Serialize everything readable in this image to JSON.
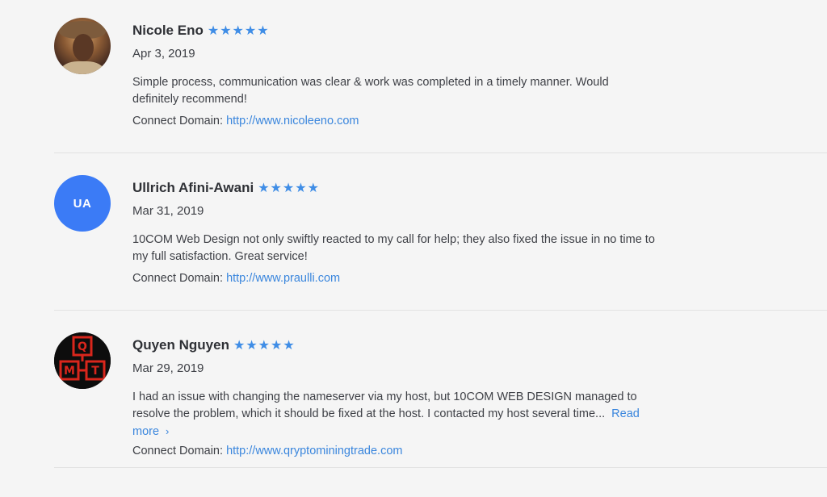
{
  "reviews": [
    {
      "name": "Nicole Eno",
      "rating": 5,
      "stars": "★★★★★",
      "date": "Apr 3, 2019",
      "text": "Simple process, communication was clear & work was completed in a timely manner. Would definitely recommend!",
      "read_more": "",
      "domain_label": "Connect Domain:",
      "domain_url": "http://www.nicoleeno.com",
      "avatar_type": "photo"
    },
    {
      "name": "Ullrich Afini-Awani",
      "rating": 5,
      "stars": "★★★★★",
      "date": "Mar 31, 2019",
      "text": "10COM Web Design not only swiftly reacted to my call for help; they also fixed the issue in no time to my full satisfaction. Great service!",
      "read_more": "",
      "domain_label": "Connect Domain:",
      "domain_url": "http://www.praulli.com",
      "avatar_type": "initials",
      "avatar_initials": "UA",
      "avatar_color": "#3b7bf6"
    },
    {
      "name": "Quyen Nguyen",
      "rating": 5,
      "stars": "★★★★★",
      "date": "Mar 29, 2019",
      "text": "I had an issue with changing the nameserver via my host, but 10COM WEB DESIGN managed to resolve the problem, which it should be fixed at the host. I contacted my host several time...",
      "read_more": "Read more",
      "read_more_icon": "chevron-right-icon",
      "domain_label": "Connect Domain:",
      "domain_url": "http://www.qryptominingtrade.com",
      "avatar_type": "logo",
      "avatar_logo_letters": [
        "Q",
        "M",
        "T"
      ]
    }
  ],
  "colors": {
    "background": "#f5f5f5",
    "star": "#3f8de6",
    "link": "#3a86dd",
    "avatar_initials_bg": "#3b7bf6",
    "logo_red": "#d9261c"
  }
}
